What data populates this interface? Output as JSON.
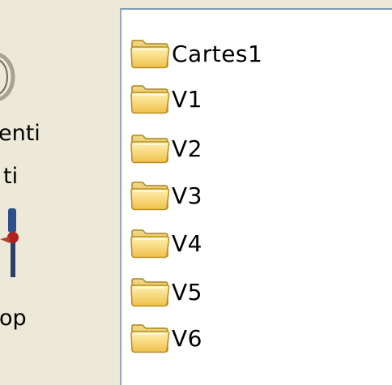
{
  "left_panel": {
    "items": [
      {
        "label": "enti"
      },
      {
        "label": "ti"
      },
      {
        "label": "op"
      }
    ]
  },
  "file_list": {
    "folders": [
      {
        "name": "Cartes1",
        "icon": "folder-icon"
      },
      {
        "name": "V1",
        "icon": "folder-icon"
      },
      {
        "name": "V2",
        "icon": "folder-icon"
      },
      {
        "name": "V3",
        "icon": "folder-icon"
      },
      {
        "name": "V4",
        "icon": "folder-icon"
      },
      {
        "name": "V5",
        "icon": "folder-icon"
      },
      {
        "name": "V6",
        "icon": "folder-icon"
      }
    ]
  },
  "colors": {
    "window_bg": "#ece9d8",
    "list_bg": "#ffffff",
    "folder_yellow": "#f7d774"
  }
}
